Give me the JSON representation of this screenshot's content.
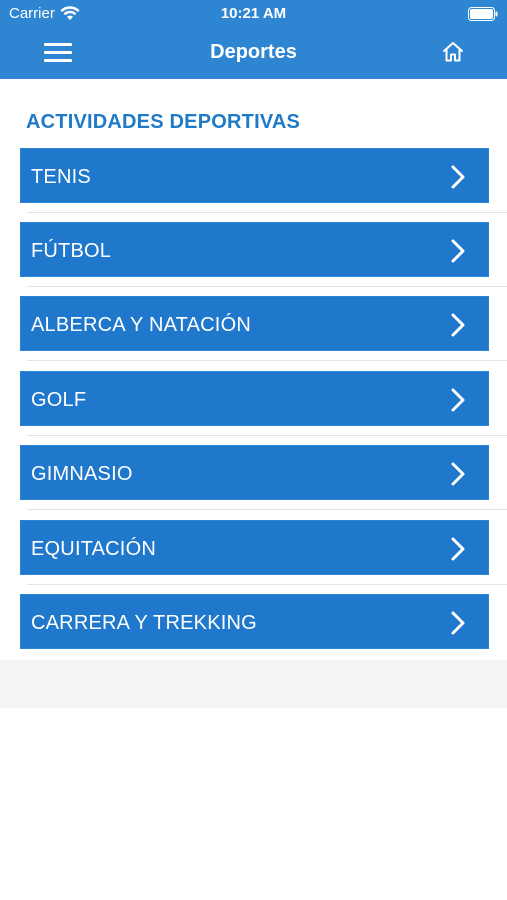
{
  "status_bar": {
    "carrier": "Carrier",
    "time": "10:21 AM"
  },
  "header": {
    "title": "Deportes",
    "menu_icon": "hamburger-menu-icon",
    "home_icon": "home-icon",
    "background_color": "#2e86d3"
  },
  "section": {
    "title": "ACTIVIDADES DEPORTIVAS",
    "title_color": "#1f7bc8"
  },
  "items": [
    {
      "label": "TENIS"
    },
    {
      "label": "FÚTBOL"
    },
    {
      "label": "ALBERCA Y NATACIÓN"
    },
    {
      "label": "GOLF"
    },
    {
      "label": "GIMNASIO"
    },
    {
      "label": "EQUITACIÓN"
    },
    {
      "label": "CARRERA Y TREKKING"
    }
  ],
  "item_style": {
    "background_color": "#1f78cb",
    "chevron_icon": "chevron-right-icon"
  }
}
